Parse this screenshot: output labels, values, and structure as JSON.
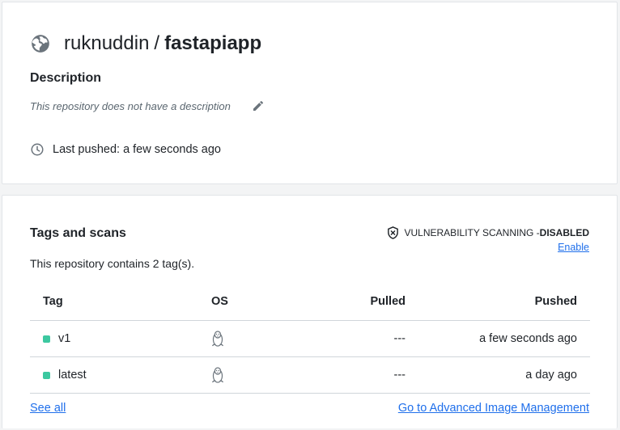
{
  "repo": {
    "owner": "ruknuddin",
    "separator": "/",
    "name": "fastapiapp",
    "description_heading": "Description",
    "description": "This repository does not have a description",
    "last_pushed": "Last pushed: a few seconds ago"
  },
  "tags": {
    "heading": "Tags and scans",
    "vuln_label": "VULNERABILITY SCANNING - ",
    "vuln_status": "DISABLED",
    "enable_link": "Enable",
    "count_text": "This repository contains 2 tag(s).",
    "columns": {
      "tag": "Tag",
      "os": "OS",
      "pulled": "Pulled",
      "pushed": "Pushed"
    },
    "rows": [
      {
        "tag": "v1",
        "os_icon": "linux-icon",
        "pulled": "---",
        "pushed": "a few seconds ago"
      },
      {
        "tag": "latest",
        "os_icon": "linux-icon",
        "pulled": "---",
        "pushed": "a day ago"
      }
    ],
    "see_all": "See all",
    "advanced_link": "Go to Advanced Image Management"
  },
  "colors": {
    "link": "#1f6feb",
    "status_dot": "#3cc8a0",
    "icon_gray": "#6b747c"
  }
}
